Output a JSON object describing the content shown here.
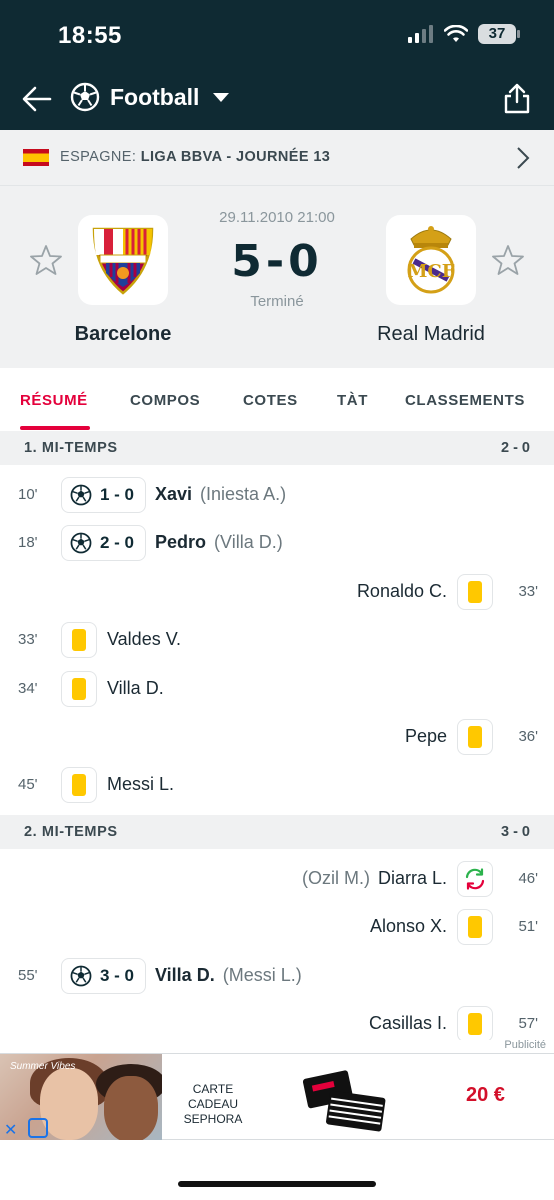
{
  "status_bar": {
    "time": "18:55",
    "battery": "37"
  },
  "header": {
    "sport": "Football"
  },
  "league": {
    "country": "ESPAGNE:",
    "competition": "LIGA BBVA - JOURNÉE 13"
  },
  "match": {
    "datetime": "29.11.2010 21:00",
    "score": "5-0",
    "status": "Terminé",
    "home_team": "Barcelone",
    "away_team": "Real Madrid"
  },
  "tabs": [
    "RÉSUMÉ",
    "COMPOS",
    "COTES",
    "TÀT",
    "CLASSEMENTS"
  ],
  "sections": {
    "first_half": {
      "label": "1. MI-TEMPS",
      "score": "2 - 0"
    },
    "second_half": {
      "label": "2. MI-TEMPS",
      "score": "3 - 0"
    }
  },
  "events": [
    {
      "minute": "10'",
      "score": "1 - 0",
      "player": "Xavi",
      "assist": "(Iniesta A.)"
    },
    {
      "minute": "18'",
      "score": "2 - 0",
      "player": "Pedro",
      "assist": "(Villa D.)"
    },
    {
      "minute": "33'",
      "player": "Ronaldo C."
    },
    {
      "minute": "33'",
      "player": "Valdes V."
    },
    {
      "minute": "34'",
      "player": "Villa D."
    },
    {
      "minute": "36'",
      "player": "Pepe"
    },
    {
      "minute": "45'",
      "player": "Messi L."
    },
    {
      "minute": "46'",
      "player": "Diarra L.",
      "sub_out": "(Ozil M.)"
    },
    {
      "minute": "51'",
      "player": "Alonso X."
    },
    {
      "minute": "55'",
      "score": "3 - 0",
      "player": "Villa D.",
      "assist": "(Messi L.)"
    },
    {
      "minute": "57'",
      "player": "Casillas I."
    }
  ],
  "ad": {
    "label": "Publicité",
    "tagline": "Summer Vibes",
    "line1": "CARTE CADEAU",
    "line2": "SEPHORA",
    "price": "20 €"
  },
  "colors": {
    "header_bg": "#0f2a33",
    "accent": "#e4003b",
    "yellow_card": "#ffc800"
  }
}
